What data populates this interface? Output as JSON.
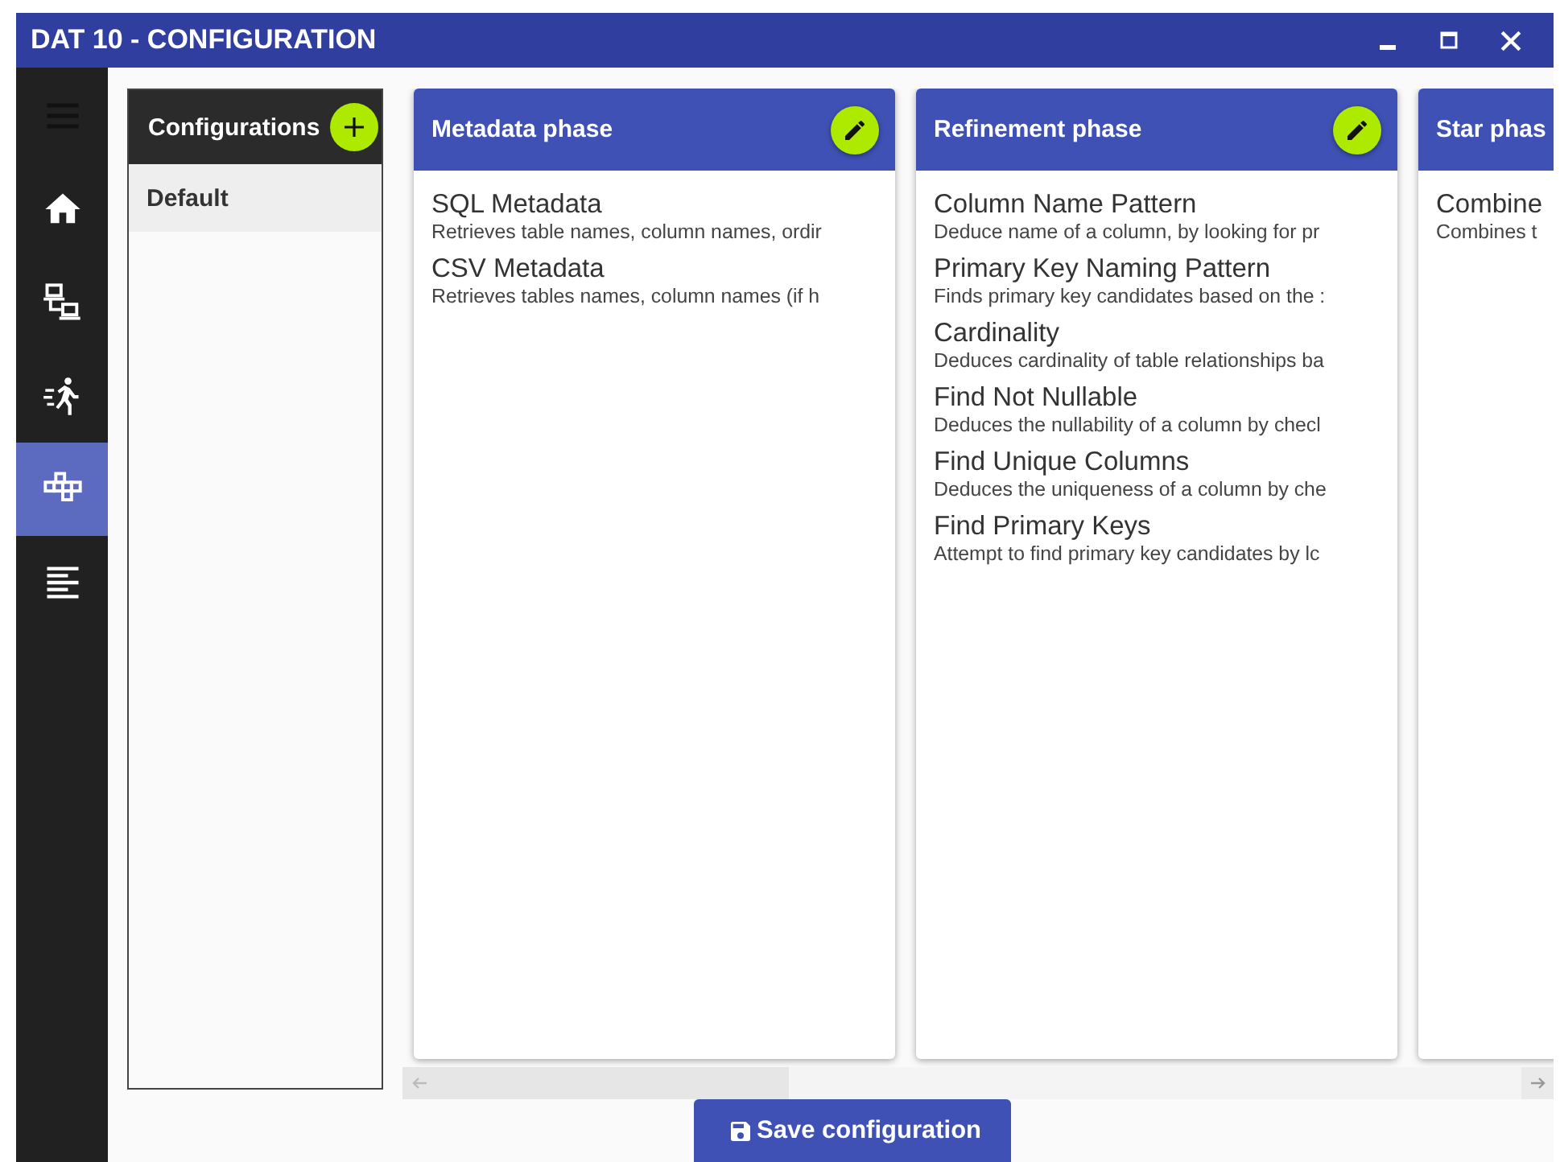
{
  "window": {
    "title": "DAT 10 - CONFIGURATION"
  },
  "sidebar": {
    "items": [
      {
        "selected": false
      },
      {
        "selected": false
      },
      {
        "selected": false
      },
      {
        "selected": false
      },
      {
        "selected": true
      },
      {
        "selected": false
      }
    ]
  },
  "configurations": {
    "title": "Configurations",
    "items": [
      {
        "label": "Default",
        "selected": true
      }
    ]
  },
  "phases": [
    {
      "title": "Metadata phase",
      "editable": true,
      "modules": [
        {
          "name": "SQL Metadata",
          "description": "Retrieves table names, column names, ordir"
        },
        {
          "name": "CSV Metadata",
          "description": "Retrieves tables names, column names (if h"
        }
      ]
    },
    {
      "title": "Refinement phase",
      "editable": true,
      "modules": [
        {
          "name": "Column Name Pattern",
          "description": "Deduce name of a column, by looking for pr"
        },
        {
          "name": "Primary Key Naming Pattern",
          "description": "Finds primary key candidates based on the :"
        },
        {
          "name": "Cardinality",
          "description": "Deduces cardinality of table relationships ba"
        },
        {
          "name": "Find Not Nullable",
          "description": "Deduces the nullability of a column by checl"
        },
        {
          "name": "Find Unique Columns",
          "description": "Deduces the uniqueness of a column by che"
        },
        {
          "name": "Find Primary Keys",
          "description": "Attempt to find primary key candidates by lc"
        }
      ]
    },
    {
      "title": "Star phas",
      "modules": [
        {
          "name": "Combine",
          "description": "Combines t"
        }
      ]
    }
  ],
  "save_button": {
    "label": "Save configuration"
  }
}
